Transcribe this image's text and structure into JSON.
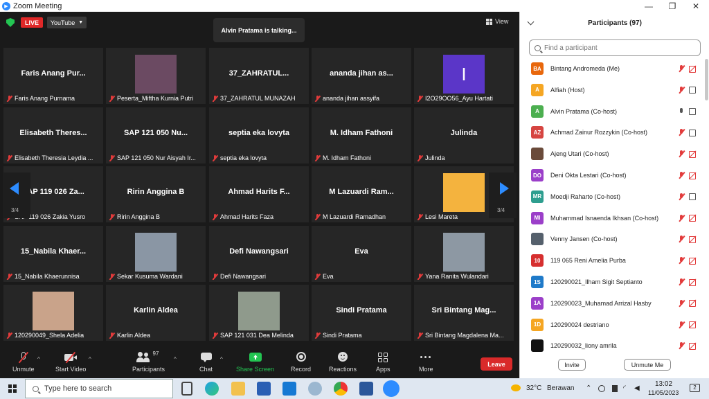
{
  "window": {
    "title": "Zoom Meeting",
    "minimize": "—",
    "maximize": "❐",
    "close": "✕"
  },
  "meeting": {
    "live_badge": "LIVE",
    "stream_target": "YouTube",
    "talking_banner": "Alvin Pratama is talking...",
    "view_label": "View",
    "page_left": "3/4",
    "page_right": "3/4"
  },
  "tiles": [
    {
      "name": "Faris Anang Pur...",
      "label": "Faris Anang Purnama",
      "kind": "text"
    },
    {
      "name": "",
      "label": "Peserta_Miftha Kurnia Putri",
      "kind": "photo",
      "color": "#6b4a62"
    },
    {
      "name": "37_ZAHRATUL...",
      "label": "37_ZAHRATUL MUNAZAH",
      "kind": "text"
    },
    {
      "name": "ananda jihan as...",
      "label": "ananda jihan assyifa",
      "kind": "text"
    },
    {
      "name": "I",
      "label": "I2O29OO56_Ayu Hartati",
      "kind": "letter",
      "color": "#5b36c8"
    },
    {
      "name": "Elisabeth Theres...",
      "label": "Elisabeth Theresia Leydia ...",
      "kind": "text"
    },
    {
      "name": "SAP 121 050 Nu...",
      "label": "SAP 121 050 Nur Aisyah Ir...",
      "kind": "text"
    },
    {
      "name": "septia eka lovyta",
      "label": "septia eka lovyta",
      "kind": "text"
    },
    {
      "name": "M. Idham Fathoni",
      "label": "M. Idham Fathoni",
      "kind": "text"
    },
    {
      "name": "Julinda",
      "label": "Julinda",
      "kind": "text"
    },
    {
      "name": "SAP 119 026 Za...",
      "label": "SAP 119 026 Zakia Yusro",
      "kind": "text"
    },
    {
      "name": "Ririn Anggina B",
      "label": "Ririn Anggina B",
      "kind": "text"
    },
    {
      "name": "Ahmad Harits F...",
      "label": "Ahmad Harits Faza",
      "kind": "text"
    },
    {
      "name": "M Lazuardi Ram...",
      "label": "M Lazuardi Ramadhan",
      "kind": "text"
    },
    {
      "name": "",
      "label": "Lesi Mareta",
      "kind": "photo",
      "color": "#f4b33e"
    },
    {
      "name": "15_Nabila Khaer...",
      "label": "15_Nabila Khaerunnisa",
      "kind": "text"
    },
    {
      "name": "",
      "label": "Sekar Kusuma Wardani",
      "kind": "photo",
      "color": "#8a96a4"
    },
    {
      "name": "Defi Nawangsari",
      "label": "Defi Nawangsari",
      "kind": "text"
    },
    {
      "name": "Eva",
      "label": "Eva",
      "kind": "text"
    },
    {
      "name": "",
      "label": "Yana Ranita Wulandari",
      "kind": "photo",
      "color": "#8d98a3"
    },
    {
      "name": "",
      "label": "120290049_Shela Adelia",
      "kind": "photo",
      "color": "#c9a38a"
    },
    {
      "name": "Karlin Aldea",
      "label": "Karlin Aldea",
      "kind": "text"
    },
    {
      "name": "",
      "label": "SAP 121 031 Dea Melinda",
      "kind": "photo",
      "color": "#8f9a8c"
    },
    {
      "name": "Sindi Pratama",
      "label": "Sindi Pratama",
      "kind": "text"
    },
    {
      "name": "Sri Bintang Mag...",
      "label": "Sri Bintang Magdalena Ma...",
      "kind": "text"
    }
  ],
  "toolbar": {
    "unmute": "Unmute",
    "start_video": "Start Video",
    "participants": "Participants",
    "participants_count": "97",
    "chat": "Chat",
    "share_screen": "Share Screen",
    "record": "Record",
    "reactions": "Reactions",
    "apps": "Apps",
    "more": "More",
    "leave": "Leave"
  },
  "panel": {
    "title": "Participants (97)",
    "search_placeholder": "Find a participant",
    "participants": [
      {
        "initials": "BA",
        "name": "Bintang Andromeda (Me)",
        "color": "#e8670c",
        "mic": "muted",
        "cam": "off"
      },
      {
        "initials": "A",
        "name": "Alfiah (Host)",
        "color": "#f5a623",
        "mic": "muted",
        "cam": "on"
      },
      {
        "initials": "A",
        "name": "Alvin Pratama (Co-host)",
        "color": "#4caf50",
        "mic": "on",
        "cam": "on"
      },
      {
        "initials": "AZ",
        "name": "Achmad Zainur Rozzykin (Co-host)",
        "color": "#d64541",
        "mic": "muted",
        "cam": "on"
      },
      {
        "initials": "",
        "name": "Ajeng Utari (Co-host)",
        "color": "#6a4b3a",
        "mic": "muted",
        "cam": "off"
      },
      {
        "initials": "DO",
        "name": "Deni Okta Lestari (Co-host)",
        "color": "#9b3fc9",
        "mic": "muted",
        "cam": "off"
      },
      {
        "initials": "MR",
        "name": "Moedji Raharto (Co-host)",
        "color": "#2e9e8f",
        "mic": "muted",
        "cam": "on"
      },
      {
        "initials": "MI",
        "name": "Muhammad Isnaenda Ikhsan (Co-host)",
        "color": "#9b3fc9",
        "mic": "muted",
        "cam": "off"
      },
      {
        "initials": "",
        "name": "Venny Jansen (Co-host)",
        "color": "#55606c",
        "mic": "muted",
        "cam": "off"
      },
      {
        "initials": "10",
        "name": "119 065 Reni Amelia Purba",
        "color": "#d62f2f",
        "mic": "muted",
        "cam": "off"
      },
      {
        "initials": "1S",
        "name": "120290021_Ilham Sigit Septianto",
        "color": "#1f7ac9",
        "mic": "muted",
        "cam": "off"
      },
      {
        "initials": "1A",
        "name": "120290023_Muhamad Arrizal Hasby",
        "color": "#9b3fc9",
        "mic": "muted",
        "cam": "off"
      },
      {
        "initials": "1D",
        "name": "120290024 destriano",
        "color": "#f5a623",
        "mic": "muted",
        "cam": "off"
      },
      {
        "initials": "",
        "name": "120290032_liony amrila",
        "color": "#111111",
        "mic": "muted",
        "cam": "off"
      }
    ],
    "invite": "Invite",
    "unmute_me": "Unmute Me"
  },
  "taskbar": {
    "search_placeholder": "Type here to search",
    "temperature": "32°C",
    "weather": "Berawan",
    "time": "13:02",
    "date": "11/05/2023",
    "notifications": "2"
  }
}
